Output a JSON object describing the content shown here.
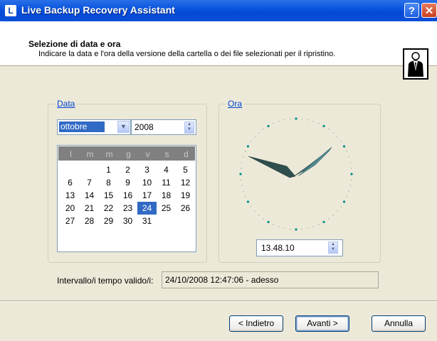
{
  "window": {
    "title": "Live Backup Recovery Assistant",
    "app_icon_glyph": "L",
    "help_glyph": "?",
    "close_glyph": "✕"
  },
  "header": {
    "title": "Selezione di data e ora",
    "subtitle": "Indicare la data e l'ora della versione della cartella o dei file selezionati per il ripristino.",
    "icon": "person-icon"
  },
  "date_group": {
    "label": "Data",
    "month": "ottobre",
    "year": "2008",
    "weekdays": [
      "l",
      "m",
      "m",
      "g",
      "v",
      "s",
      "d"
    ],
    "weeks": [
      [
        "",
        "",
        "1",
        "2",
        "3",
        "4",
        "5"
      ],
      [
        "6",
        "7",
        "8",
        "9",
        "10",
        "11",
        "12"
      ],
      [
        "13",
        "14",
        "15",
        "16",
        "17",
        "18",
        "19"
      ],
      [
        "20",
        "21",
        "22",
        "23",
        "24",
        "25",
        "26"
      ],
      [
        "27",
        "28",
        "29",
        "30",
        "31",
        "",
        ""
      ]
    ],
    "selected_day": "24"
  },
  "time_group": {
    "label": "Ora",
    "time": "13.48.10"
  },
  "interval": {
    "label": "Intervallo/i tempo valido/i:",
    "value": "24/10/2008 12:47:06 - adesso"
  },
  "buttons": {
    "back": "< Indietro",
    "next": "Avanti >",
    "cancel": "Annulla"
  },
  "colors": {
    "title_bar": "#0a56de",
    "selection": "#316ac5",
    "clock_hands": "#2f4f4f"
  }
}
